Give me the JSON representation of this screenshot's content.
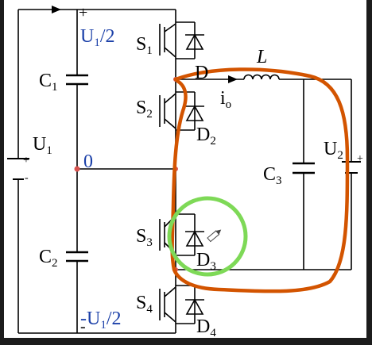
{
  "labels": {
    "top_plus": "+",
    "top_voltage": {
      "main": "U",
      "sub": "1",
      "tail": "/2"
    },
    "bottom_minus": "-",
    "bottom_voltage": {
      "main": "-U",
      "sub": "1",
      "tail": "/2"
    },
    "c1": {
      "main": "C",
      "sub": "1"
    },
    "c2": {
      "main": "C",
      "sub": "2"
    },
    "c3": {
      "main": "C",
      "sub": "3"
    },
    "u1": {
      "main": "U",
      "sub": "1"
    },
    "u2": {
      "main": "U",
      "sub": "2"
    },
    "neutral": "0",
    "s1": {
      "main": "S",
      "sub": "1"
    },
    "s2": {
      "main": "S",
      "sub": "2"
    },
    "s3": {
      "main": "S",
      "sub": "3"
    },
    "s4": {
      "main": "S",
      "sub": "4"
    },
    "d1": "D",
    "d2": {
      "main": "D",
      "sub": "2"
    },
    "d3": {
      "main": "D",
      "sub": "3"
    },
    "d4": {
      "main": "D",
      "sub": "4"
    },
    "inductor": "L",
    "current": {
      "main": "i",
      "sub": "o"
    },
    "battery_plus": "+",
    "battery_minus": "-"
  },
  "colors": {
    "wire": "#000000",
    "label_blue": "#1a3fa8",
    "node_dot": "#d9534f",
    "annotation_orange": "#d35400",
    "annotation_green": "#7ed957",
    "background": "#ffffff",
    "frame": "#1c1c1c"
  },
  "icons": {
    "cursor": "pencil-icon"
  }
}
